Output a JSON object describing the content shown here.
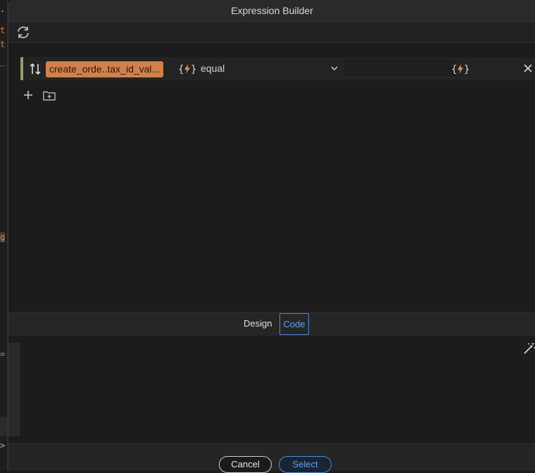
{
  "window": {
    "title": "Expression Builder"
  },
  "toolbar": {
    "refresh_icon": "refresh-icon"
  },
  "left_editor_glyphs": [
    {
      "text": "t",
      "color": "#d4804b"
    },
    {
      "text": "t",
      "color": "#d4804b"
    },
    {
      "text": "g",
      "color": "#d4804b"
    },
    {
      "text": "=",
      "color": "#d4804b"
    },
    {
      "text": ">",
      "color": "#bdbdbd"
    }
  ],
  "condition": {
    "field_label": "create_orde..tax_id_val...",
    "operator_value": "equal",
    "value_placeholder": "",
    "accent_color": "#8e9e6f",
    "chip_color": "#d4804b",
    "dynamic_icon": "dynamic-data-icon"
  },
  "actions": {
    "add_icon": "plus-icon",
    "add_group_icon": "folder-plus-icon"
  },
  "tabs": [
    {
      "label": "Design",
      "active": false
    },
    {
      "label": "Code",
      "active": true
    }
  ],
  "footer": {
    "cancel_label": "Cancel",
    "select_label": "Select",
    "accent_color": "#4c8cdc"
  }
}
